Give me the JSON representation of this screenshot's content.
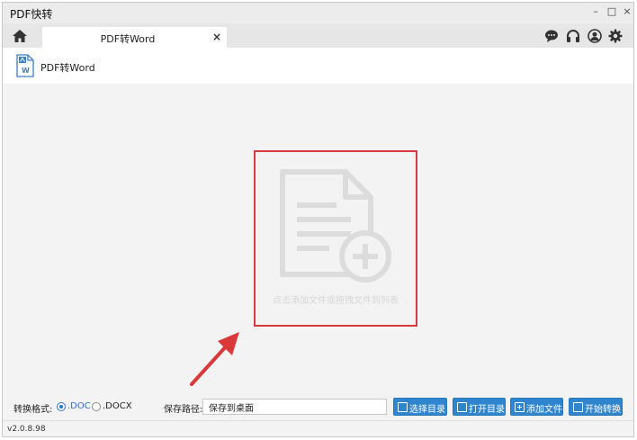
{
  "window": {
    "title": "PDF快转",
    "minimize": "–",
    "maximize": "□",
    "close": "×"
  },
  "tabbar": {
    "home_icon": "home-icon",
    "tabs": [
      {
        "label": "PDF转Word",
        "close": "×",
        "active": true
      }
    ],
    "right_icons": [
      "chat-icon",
      "headset-icon",
      "user-icon",
      "gear-icon"
    ]
  },
  "toolbar": {
    "item_label": "PDF转Word",
    "item_icon": "word-file-icon"
  },
  "drop_zone": {
    "hint": "点击添加文件或拖拽文件到列表",
    "icon": "add-document-icon",
    "highlight_color": "#d9393a"
  },
  "annotation": {
    "arrow_color": "#d9393a"
  },
  "format": {
    "label": "转换格式:",
    "options": [
      {
        "label": ".DOC",
        "selected": true
      },
      {
        "label": ".DOCX",
        "selected": false
      }
    ]
  },
  "save_path": {
    "label": "保存路径:",
    "value": "保存到桌面"
  },
  "buttons": {
    "select_dir": "选择目录",
    "open_dir": "打开目录",
    "add_file": "添加文件",
    "start": "开始转换"
  },
  "status": {
    "version": "v2.0.8.98"
  },
  "colors": {
    "accent": "#2f86cf",
    "highlight": "#d9393a"
  }
}
